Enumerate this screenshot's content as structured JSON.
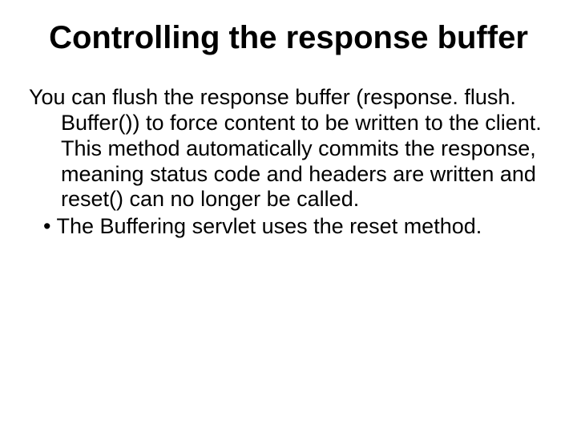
{
  "slide": {
    "title": "Controlling the response buffer",
    "paragraph": "You can flush the response buffer (response. flush. Buffer()) to force content to be written to the client.  This method automatically commits the response, meaning status code and headers are written and reset() can no longer be called.",
    "bullet1": "The Buffering servlet uses the reset method."
  }
}
